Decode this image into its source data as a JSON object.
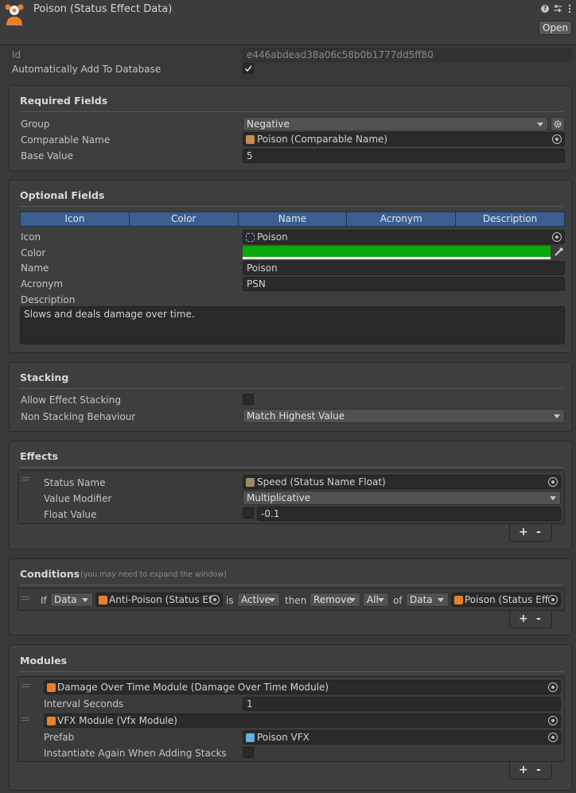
{
  "header": {
    "title": "Poison (Status Effect Data)",
    "open_label": "Open",
    "icons": [
      "help-icon",
      "settings-sliders-icon",
      "more-vert-icon"
    ]
  },
  "top": {
    "id_label": "Id",
    "id_value": "e446abdead38a06c58b0b1777dd5ff80",
    "auto_add_label": "Automatically Add To Database",
    "auto_add_checked": true
  },
  "required": {
    "title": "Required Fields",
    "group_label": "Group",
    "group_value": "Negative",
    "comparable_label": "Comparable Name",
    "comparable_value": "Poison (Comparable Name)",
    "base_label": "Base Value",
    "base_value": "5"
  },
  "optional": {
    "title": "Optional Fields",
    "tabs": [
      "Icon",
      "Color",
      "Name",
      "Acronym",
      "Description"
    ],
    "icon_label": "Icon",
    "icon_value": "Poison",
    "color_label": "Color",
    "color_value": "#0aa90a",
    "name_label": "Name",
    "name_value": "Poison",
    "acronym_label": "Acronym",
    "acronym_value": "PSN",
    "description_label": "Description",
    "description_value": "Slows and deals damage over time."
  },
  "stacking": {
    "title": "Stacking",
    "allow_label": "Allow Effect Stacking",
    "allow_checked": false,
    "behaviour_label": "Non Stacking Behaviour",
    "behaviour_value": "Match Highest Value"
  },
  "effects": {
    "title": "Effects",
    "status_label": "Status Name",
    "status_value": "Speed (Status Name Float)",
    "modifier_label": "Value Modifier",
    "modifier_value": "Multiplicative",
    "float_label": "Float Value",
    "float_value": "-0.1",
    "plus": "+",
    "minus": "-"
  },
  "conditions": {
    "title": "Conditions",
    "hint": "(you may need to expand the window)",
    "if": "If",
    "src1": "Data",
    "obj1": "Anti-Poison (Status Eff",
    "is": "is",
    "state": "Active",
    "then": "then",
    "action": "Remove",
    "scope": "All",
    "of": "of",
    "src2": "Data",
    "obj2": "Poison (Status Eff",
    "plus": "+",
    "minus": "-"
  },
  "modules": {
    "title": "Modules",
    "dot_value": "Damage Over Time Module (Damage Over Time Module)",
    "interval_label": "Interval Seconds",
    "interval_value": "1",
    "vfx_value": "VFX Module (Vfx Module)",
    "prefab_label": "Prefab",
    "prefab_value": "Poison VFX",
    "instantiate_label": "Instantiate Again When Adding Stacks",
    "instantiate_checked": false,
    "plus": "+",
    "minus": "-"
  },
  "colors": {
    "background": "#383838",
    "section": "#3e3e3e",
    "tab_header": "#3a5f8e",
    "poison_green": "#0aa90a",
    "asset_orange": "#e8802a"
  }
}
